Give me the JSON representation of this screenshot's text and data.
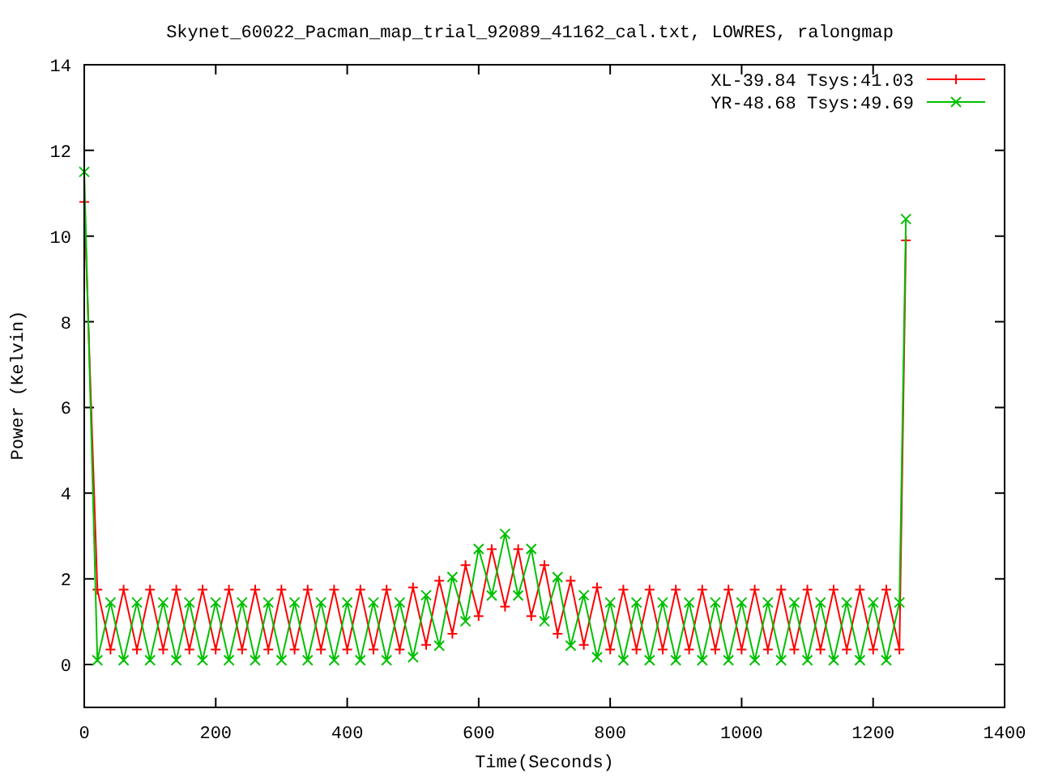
{
  "chart_data": {
    "type": "line",
    "title": "Skynet_60022_Pacman_map_trial_92089_41162_cal.txt, LOWRES, ralongmap",
    "xlabel": "Time(Seconds)",
    "ylabel": "Power (Kelvin)",
    "x": [
      0,
      20,
      40,
      60,
      80,
      100,
      120,
      140,
      160,
      180,
      200,
      220,
      240,
      260,
      280,
      300,
      320,
      340,
      360,
      380,
      400,
      420,
      440,
      460,
      480,
      500,
      520,
      540,
      560,
      580,
      600,
      620,
      640,
      660,
      680,
      700,
      720,
      740,
      760,
      780,
      800,
      820,
      840,
      860,
      880,
      900,
      920,
      940,
      960,
      980,
      1000,
      1020,
      1040,
      1060,
      1080,
      1100,
      1120,
      1140,
      1160,
      1180,
      1200,
      1220,
      1240,
      1250
    ],
    "series": [
      {
        "name": "XL-39.84 Tsys:41.03",
        "color": "#ff0000",
        "marker": "plus",
        "values": [
          10.8,
          1.75,
          0.35,
          1.75,
          0.35,
          1.75,
          0.35,
          1.75,
          0.35,
          1.75,
          0.35,
          1.75,
          0.35,
          1.75,
          0.35,
          1.75,
          0.35,
          1.75,
          0.35,
          1.75,
          0.35,
          1.75,
          0.35,
          1.75,
          0.35,
          1.8,
          0.46,
          1.96,
          0.72,
          2.32,
          1.13,
          2.69,
          1.35,
          2.69,
          1.13,
          2.32,
          0.72,
          1.96,
          0.46,
          1.8,
          0.35,
          1.75,
          0.35,
          1.75,
          0.35,
          1.75,
          0.35,
          1.75,
          0.35,
          1.75,
          0.35,
          1.75,
          0.35,
          1.75,
          0.35,
          1.75,
          0.35,
          1.75,
          0.35,
          1.75,
          0.35,
          1.75,
          0.35,
          9.9
        ]
      },
      {
        "name": "YR-48.68 Tsys:49.69",
        "color": "#00c000",
        "marker": "cross",
        "values": [
          11.5,
          0.1,
          1.45,
          0.1,
          1.45,
          0.1,
          1.45,
          0.1,
          1.45,
          0.1,
          1.45,
          0.1,
          1.45,
          0.1,
          1.45,
          0.1,
          1.45,
          0.1,
          1.45,
          0.1,
          1.45,
          0.1,
          1.45,
          0.1,
          1.45,
          0.17,
          1.62,
          0.44,
          2.04,
          1.01,
          2.7,
          1.61,
          3.05,
          1.61,
          2.7,
          1.01,
          2.04,
          0.44,
          1.62,
          0.17,
          1.45,
          0.1,
          1.45,
          0.1,
          1.45,
          0.1,
          1.45,
          0.1,
          1.45,
          0.1,
          1.45,
          0.1,
          1.45,
          0.1,
          1.45,
          0.1,
          1.45,
          0.1,
          1.45,
          0.1,
          1.45,
          0.1,
          1.45,
          10.4
        ]
      }
    ],
    "legend": true,
    "xlim": [
      0,
      1400
    ],
    "ylim": [
      -1,
      14
    ],
    "xticks": [
      0,
      200,
      400,
      600,
      800,
      1000,
      1200,
      1400
    ],
    "yticks": [
      0,
      2,
      4,
      6,
      8,
      10,
      12,
      14
    ]
  }
}
